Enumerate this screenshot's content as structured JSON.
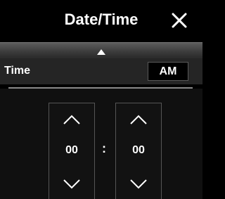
{
  "header": {
    "title": "Date/Time",
    "close_icon": "close-icon"
  },
  "band": {
    "icon": "caret-up-icon"
  },
  "time_row": {
    "label": "Time",
    "ampm_button": "AM"
  },
  "spinners": {
    "hour": {
      "value": "00",
      "up_icon": "chevron-up-icon",
      "down_icon": "chevron-down-icon"
    },
    "minute": {
      "value": "00",
      "up_icon": "chevron-up-icon",
      "down_icon": "chevron-down-icon"
    },
    "separator": ":"
  },
  "colors": {
    "background": "#000000",
    "band": "#4a4a4a",
    "text": "#ffffff",
    "divider": "#8a8a8a"
  }
}
